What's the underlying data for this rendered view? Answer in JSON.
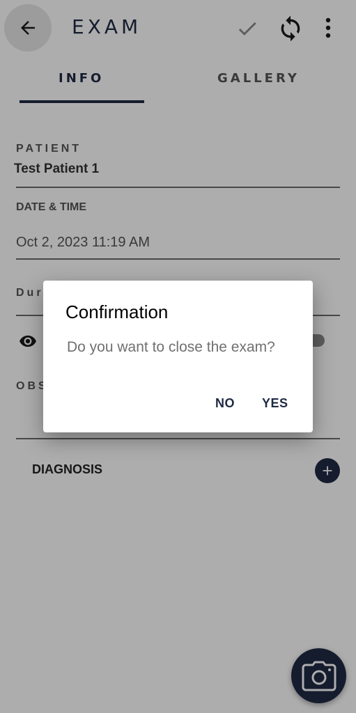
{
  "appbar": {
    "title": "EXAM",
    "back_icon": "arrow-left-icon",
    "confirm_icon": "check-icon",
    "sync_icon": "sync-icon",
    "more_icon": "more-vertical-icon"
  },
  "tabs": [
    {
      "label": "INFO",
      "selected": true
    },
    {
      "label": "GALLERY",
      "selected": false
    }
  ],
  "form": {
    "patient_label": "PATIENT",
    "patient_value": "Test Patient 1",
    "datetime_label": "DATE & TIME",
    "datetime_value": "Oct 2, 2023 11:19 AM",
    "duration_label": "Dur",
    "observations_label": "OBS",
    "diagnosis_label": "DIAGNOSIS"
  },
  "dialog": {
    "title": "Confirmation",
    "message": "Do you want to close the exam?",
    "no_label": "NO",
    "yes_label": "YES"
  },
  "colors": {
    "primary": "#1f2a44",
    "scrim": "rgba(0,0,0,0.32)"
  }
}
